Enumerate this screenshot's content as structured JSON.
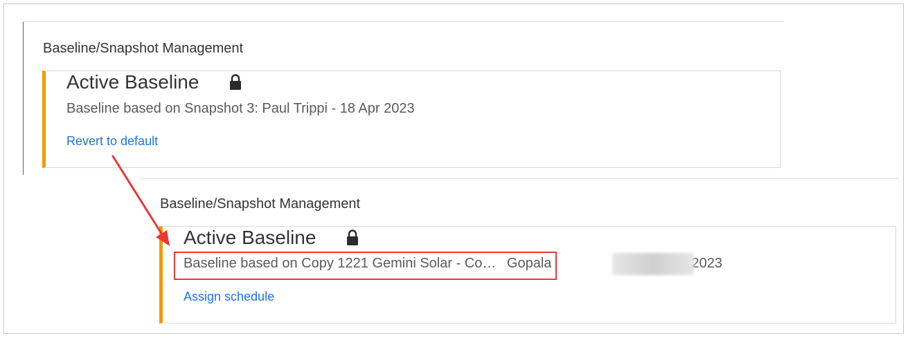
{
  "top_panel": {
    "section_title": "Baseline/Snapshot Management",
    "card": {
      "title": "Active Baseline",
      "lock_icon": "lock-icon",
      "subtitle": "Baseline based on Snapshot 3: Paul Trippi - 18 Apr 2023",
      "link": "Revert to default"
    }
  },
  "bottom_panel": {
    "section_title": "Baseline/Snapshot Management",
    "card": {
      "title": "Active Baseline",
      "lock_icon": "lock-icon",
      "subtitle_truncated": "Baseline based on Copy 1221 Gemini Solar - Co…",
      "subtitle_user": "Gopala",
      "subtitle_date": "- 2 Feb 2023",
      "link": "Assign schedule"
    }
  },
  "colors": {
    "accent_bar": "#f29900",
    "link": "#1a73e8",
    "annotation": "#e53935"
  }
}
